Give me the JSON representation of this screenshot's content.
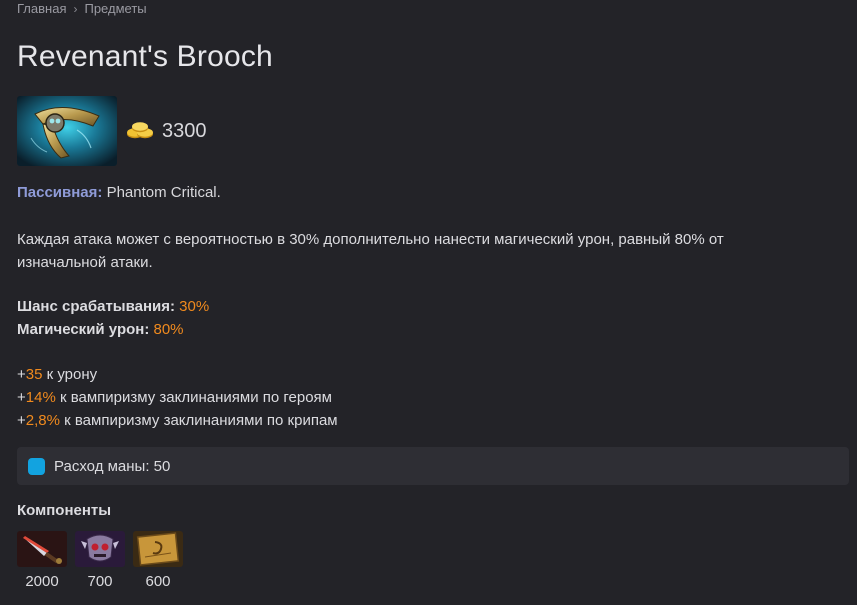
{
  "breadcrumb": {
    "home": "Главная",
    "separator": "›",
    "current": "Предметы"
  },
  "item": {
    "name": "Revenant's Brooch",
    "image_icon": "brooch-item-image",
    "price": "3300",
    "currency_icon": "gold-coins-icon"
  },
  "passive": {
    "label": "Пассивная:",
    "name": "Phantom Critical."
  },
  "description": "Каждая атака может с вероятностью в 30% дополнительно нанести магический урон, равный 80% от изначальной атаки.",
  "stats": [
    {
      "label": "Шанс срабатывания:",
      "value": "30%"
    },
    {
      "label": "Магический урон:",
      "value": "80%"
    }
  ],
  "bonuses": [
    {
      "sign": "+",
      "value": "35",
      "text": " к урону"
    },
    {
      "sign": "+",
      "value": "14%",
      "text": " к вампиризму заклинаниями по героям"
    },
    {
      "sign": "+",
      "value": "2,8%",
      "text": " к вампиризму заклинаниями по крипам"
    }
  ],
  "mana": {
    "text": "Расход маны: 50",
    "color": "#12a3e0"
  },
  "components": {
    "title": "Компоненты",
    "items": [
      {
        "icon": "dagger-item-icon",
        "cost": "2000"
      },
      {
        "icon": "skull-mask-item-icon",
        "cost": "700"
      },
      {
        "icon": "recipe-scroll-icon",
        "cost": "600"
      }
    ]
  },
  "colors": {
    "background": "#232328",
    "accent_orange": "#f08a1e",
    "passive_label": "#8f9bd8"
  }
}
